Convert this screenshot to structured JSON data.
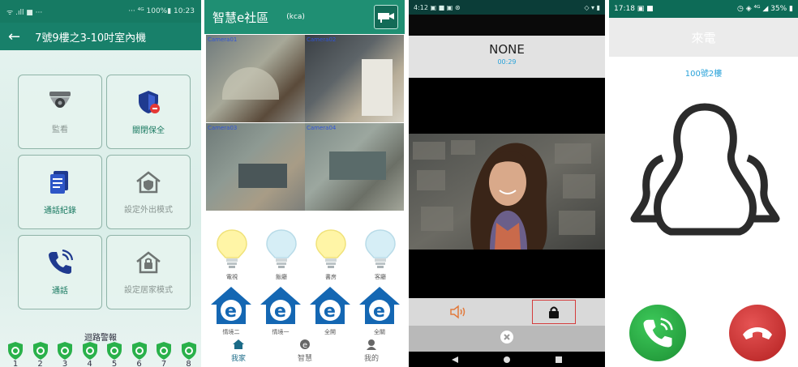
{
  "panel1": {
    "status_left": "ᯤ .ıll ■ ···",
    "status_right": "··· ⁴ᴳ 100%▮ 10:23",
    "title": "7號9樓之3-10吋室內機",
    "back_icon": "arrow-left-icon",
    "tiles": [
      {
        "label": "監看",
        "icon": "dome-camera-icon",
        "active": false
      },
      {
        "label": "關閉保全",
        "icon": "shield-off-icon",
        "active": true
      },
      {
        "label": "通話紀錄",
        "icon": "call-log-icon",
        "active": true
      },
      {
        "label": "設定外出模式",
        "icon": "home-shield-icon",
        "active": false
      },
      {
        "label": "通話",
        "icon": "phone-ring-icon",
        "active": true
      },
      {
        "label": "設定居家模式",
        "icon": "home-lock-icon",
        "active": false
      }
    ],
    "zones_title": "迴路警報",
    "zones": [
      "1",
      "2",
      "3",
      "4",
      "5",
      "6",
      "7",
      "8"
    ],
    "colors": {
      "primary": "#18806a",
      "shield": "#29b14a"
    }
  },
  "panel2": {
    "title": "智慧e社區",
    "subtitle": "(kca)",
    "cameras": [
      "Camera01",
      "Camera02",
      "Camera03",
      "Camera04"
    ],
    "bulbs": [
      {
        "label": "電視",
        "on": true
      },
      {
        "label": "飯廳",
        "on": false
      },
      {
        "label": "書房",
        "on": true
      },
      {
        "label": "客廳",
        "on": false
      }
    ],
    "scenes": [
      "情境二",
      "情境一",
      "全開",
      "全關"
    ],
    "nav": [
      {
        "label": "我家",
        "icon": "home-icon",
        "active": true
      },
      {
        "label": "智慧",
        "icon": "e-icon",
        "active": false
      },
      {
        "label": "我的",
        "icon": "user-icon",
        "active": false
      }
    ]
  },
  "panel3": {
    "status_left": "4:12 ▣ ■ ▣ ⊛",
    "status_right": "◇ ▾ ▮",
    "caller": "NONE",
    "duration": "00:29"
  },
  "panel4": {
    "status_left": "17:18 ▣ ■",
    "status_right": "◷ ◈ ⁴ᴳ ◢ 35% ▮",
    "header": "來電",
    "room": "100號2樓"
  }
}
